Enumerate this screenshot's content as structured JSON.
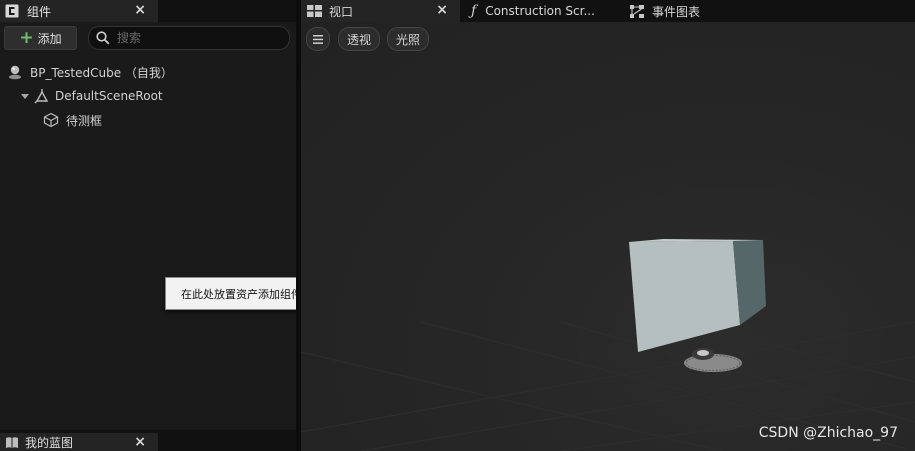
{
  "components_panel": {
    "tab_title": "组件",
    "add_button_label": "添加",
    "search_placeholder": "搜索",
    "tree": {
      "root": "BP_TestedCube （自我）",
      "scene_root": "DefaultSceneRoot",
      "child": "待测框"
    },
    "tooltip": "在此处放置资产添加组件。"
  },
  "bottom_panel": {
    "tab_title": "我的蓝图"
  },
  "editor_tabs": [
    {
      "label": "视口",
      "icon": "viewport-icon"
    },
    {
      "label": "Construction Scr...",
      "icon": "function-icon"
    },
    {
      "label": "事件图表",
      "icon": "event-graph-icon"
    }
  ],
  "viewport_toolbar": {
    "menu_icon": "hamburger-icon",
    "perspective_label": "透视",
    "lighting_label": "光照"
  },
  "watermark": "CSDN @Zhichao_97",
  "colors": {
    "panel_bg": "#1a1a1a",
    "viewport_bg": "#262626",
    "cube_front": "#b6bfbf",
    "cube_side": "#56676a",
    "add_plus": "#6ec06e"
  }
}
